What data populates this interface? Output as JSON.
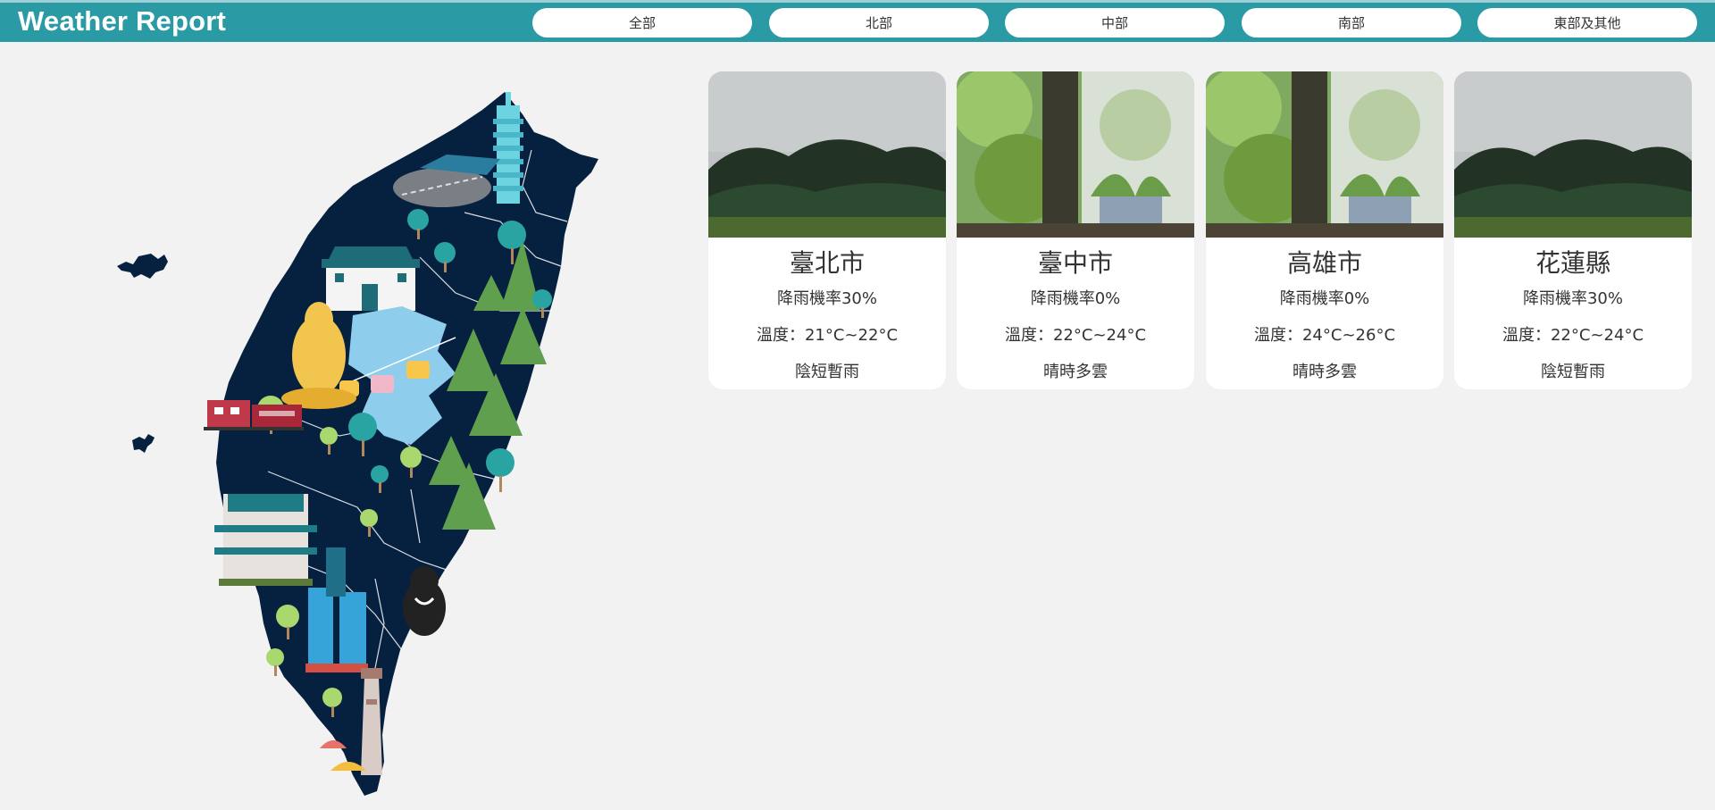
{
  "header": {
    "title": "Weather Report",
    "regions": [
      "全部",
      "北部",
      "中部",
      "南部",
      "東部及其他"
    ]
  },
  "cards": [
    {
      "city": "臺北市",
      "rain": "降雨機率30%",
      "temp": "溫度：21°C~22°C",
      "desc": "陰短暫雨",
      "photo": "misty-forest"
    },
    {
      "city": "臺中市",
      "rain": "降雨機率0%",
      "temp": "溫度：22°C~24°C",
      "desc": "晴時多雲",
      "photo": "window-plants"
    },
    {
      "city": "高雄市",
      "rain": "降雨機率0%",
      "temp": "溫度：24°C~26°C",
      "desc": "晴時多雲",
      "photo": "window-plants"
    },
    {
      "city": "花蓮縣",
      "rain": "降雨機率30%",
      "temp": "溫度：22°C~24°C",
      "desc": "陰短暫雨",
      "photo": "misty-forest"
    }
  ],
  "colors": {
    "header": "#2a9aa5",
    "map": "#06203f",
    "card": "#ffffff",
    "background": "#f2f2f2"
  }
}
